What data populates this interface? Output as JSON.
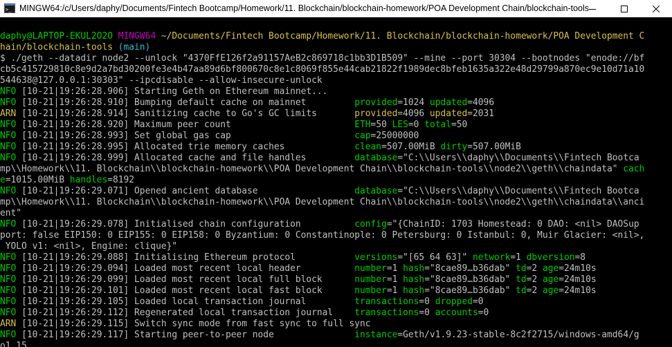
{
  "window": {
    "title": "MINGW64:/c/Users/daphy/Documents/Fintech Bootcamp/Homework/11. Blockchain/blockchain-homework/POA Development Chain/blockchain-tools",
    "icon": "mingw-terminal-icon",
    "buttons": [
      "minimize-icon",
      "maximize-icon",
      "close-icon"
    ]
  },
  "prompt": {
    "user_host": "daphy@LAPTOP-EKUL2O2O",
    "shell": "MINGW64",
    "path_part1": "~/Documents/Fintech Bootcamp/Homework/11. Blockchain/blockchain-homework/POA Development C",
    "path_part2": "hain/blockchain-tools",
    "branch": "(main)"
  },
  "command": {
    "line1": "$ ./geth --datadir node2 --unlock \"4370FfE126f2a91157AeB2c869718c1bb3D1B509\" --mine --port 30304 --bootnodes \"enode://bf",
    "line2": "cb5c415729810c8e9d2a7bd30200fe3e4b47aa89d6bf800670c8e1c8069f855e44cab21822f1989dec8bfeb1635a322e48d29799a870ec9e10d71a10",
    "line3": "544638@127.0.0.1:30303\" --ipcdisable --allow-insecure-unlock"
  },
  "log": [
    {
      "level": "INFO",
      "ts": "[10-21|19:26:28.906]",
      "msg": "Starting Geth on Ethereum mainnet...",
      "kv": []
    },
    {
      "level": "INFO",
      "ts": "[10-21|19:26:28.910]",
      "msg": "Bumping default cache on mainnet",
      "kv": [
        [
          "provided",
          "1024"
        ],
        [
          "updated",
          "4096"
        ]
      ]
    },
    {
      "level": "WARN",
      "ts": "[10-21|19:26:28.914]",
      "msg": "Sanitizing cache to Go's GC limits",
      "kv": [
        [
          "provided",
          "4096"
        ],
        [
          "updated",
          "2031"
        ]
      ]
    },
    {
      "level": "INFO",
      "ts": "[10-21|19:26:28.920]",
      "msg": "Maximum peer count",
      "kv": [
        [
          "ETH",
          "50"
        ],
        [
          "LES",
          "0"
        ],
        [
          "total",
          "50"
        ]
      ]
    },
    {
      "level": "INFO",
      "ts": "[10-21|19:26:28.993]",
      "msg": "Set global gas cap",
      "kv": [
        [
          "cap",
          "25000000"
        ]
      ]
    },
    {
      "level": "INFO",
      "ts": "[10-21|19:26:28.995]",
      "msg": "Allocated trie memory caches",
      "kv": [
        [
          "clean",
          "507.00MiB"
        ],
        [
          "dirty",
          "507.00MiB"
        ]
      ]
    },
    {
      "level": "INFO",
      "ts": "[10-21|19:26:28.999]",
      "msg": "Allocated cache and file handles",
      "kv": [
        [
          "database",
          "\"C:\\\\Users\\\\daphy\\\\Documents\\\\Fintech Bootca"
        ]
      ]
    },
    {
      "level": "INFO",
      "ts": "[10-21|19:26:29.071]",
      "msg": "Opened ancient database",
      "kv": [
        [
          "database",
          "\"C:\\\\Users\\\\daphy\\\\Documents\\\\Fintech Bootca"
        ]
      ]
    },
    {
      "level": "INFO",
      "ts": "[10-21|19:26:29.078]",
      "msg": "Initialised chain configuration",
      "kv": [
        [
          "config",
          "\"{ChainID: 1703 Homestead: 0 DAO: <nil> DAOSup"
        ]
      ]
    },
    {
      "level": "INFO",
      "ts": "[10-21|19:26:29.088]",
      "msg": "Initialising Ethereum protocol",
      "kv": [
        [
          "versions",
          "\"[65 64 63]\""
        ],
        [
          "network",
          "1"
        ],
        [
          "dbversion",
          "8"
        ]
      ]
    },
    {
      "level": "INFO",
      "ts": "[10-21|19:26:29.094]",
      "msg": "Loaded most recent local header",
      "kv": [
        [
          "number",
          "1"
        ],
        [
          "hash",
          "\"8cae89…b36dab\""
        ],
        [
          "td",
          "2"
        ],
        [
          "age",
          "24m10s"
        ]
      ]
    },
    {
      "level": "INFO",
      "ts": "[10-21|19:26:29.099]",
      "msg": "Loaded most recent local full block",
      "kv": [
        [
          "number",
          "1"
        ],
        [
          "hash",
          "\"8cae89…b36dab\""
        ],
        [
          "td",
          "2"
        ],
        [
          "age",
          "24m10s"
        ]
      ]
    },
    {
      "level": "INFO",
      "ts": "[10-21|19:26:29.101]",
      "msg": "Loaded most recent local fast block",
      "kv": [
        [
          "number",
          "1"
        ],
        [
          "hash",
          "\"8cae89…b36dab\""
        ],
        [
          "td",
          "2"
        ],
        [
          "age",
          "24m10s"
        ]
      ]
    },
    {
      "level": "INFO",
      "ts": "[10-21|19:26:29.105]",
      "msg": "Loaded local transaction journal",
      "kv": [
        [
          "transactions",
          "0"
        ],
        [
          "dropped",
          "0"
        ]
      ]
    },
    {
      "level": "INFO",
      "ts": "[10-21|19:26:29.112]",
      "msg": "Regenerated local transaction journal",
      "kv": [
        [
          "transactions",
          "0"
        ],
        [
          "accounts",
          "0"
        ]
      ]
    },
    {
      "level": "WARN",
      "ts": "[10-21|19:26:29.115]",
      "msg": "Switch sync mode from fast sync to full sync",
      "kv": []
    },
    {
      "level": "INFO",
      "ts": "[10-21|19:26:29.117]",
      "msg": "Starting peer-to-peer node",
      "kv": [
        [
          "instance",
          "Geth/v1.9.23-stable-8c2f2715/windows-amd64/g"
        ]
      ]
    }
  ],
  "wrapped": {
    "cache_line1": "mp\\\\Homework\\\\11. Blockchain\\\\blockchain-homework\\\\POA Development Chain\\\\blockchain-tools\\\\node2\\\\geth\\\\chaindata\"",
    "cache_line1_key": "cach",
    "cache_line2_key": "e",
    "cache_line2_val": "1015.00MiB",
    "cache_line2_key2": "handles",
    "cache_line2_val2": "8192",
    "ancient_line1": "mp\\\\Homework\\\\11. Blockchain\\\\blockchain-homework\\\\POA Development Chain\\\\blockchain-tools\\\\node2\\\\geth\\\\chaindata\\\\anci",
    "ancient_line2": "ent\"",
    "config_line1": "port: false EIP150: 0 EIP155: 0 EIP158: 0 Byzantium: 0 Constantinople: 0 Petersburg: 0 Istanbul: 0, Muir Glacier: <nil>,",
    "config_line2": " YOLO v1: <nil>, Engine: clique}\"",
    "instance_line2": "o1.15"
  },
  "colors": {
    "background": "#000000",
    "text": "#c0c0c0",
    "green": "#00cd00",
    "magenta": "#c000c0",
    "yellow": "#d7c14b",
    "cyan": "#3bb8c8",
    "blue": "#2f6fd6"
  }
}
